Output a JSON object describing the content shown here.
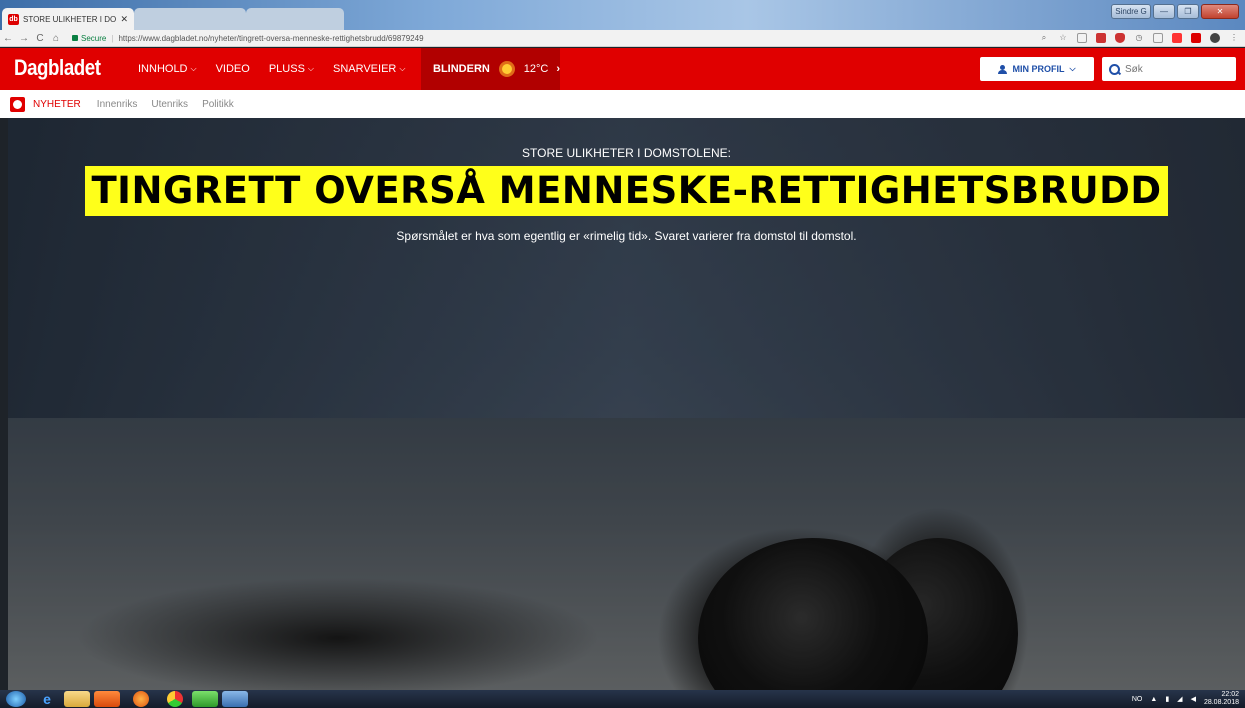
{
  "browser": {
    "tabs": [
      {
        "title": "STORE ULIKHETER I DOM",
        "active": true
      },
      {
        "title": "",
        "active": false
      },
      {
        "title": "",
        "active": false
      }
    ],
    "window_user": "Sindre G",
    "secure_label": "Secure",
    "url": "https://www.dagbladet.no/nyheter/tingrett-oversa-menneske-rettighetsbrudd/69879249"
  },
  "site": {
    "logo": "Dagbladet",
    "nav": [
      {
        "label": "INNHOLD",
        "dropdown": true
      },
      {
        "label": "VIDEO",
        "dropdown": false
      },
      {
        "label": "PLUSS",
        "dropdown": true
      },
      {
        "label": "SNARVEIER",
        "dropdown": true
      }
    ],
    "weather": {
      "location": "BLINDERN",
      "temp": "12°C",
      "icon": "sun-icon"
    },
    "profile_label": "MIN PROFIL",
    "search_placeholder": "Søk",
    "accent_color": "#e00000"
  },
  "subnav": {
    "section": "NYHETER",
    "items": [
      "Innenriks",
      "Utenriks",
      "Politikk"
    ]
  },
  "article": {
    "kicker": "STORE ULIKHETER I DOMSTOLENE:",
    "headline": "TINGRETT OVERSÅ MENNESKE-RETTIGHETSBRUDD",
    "lead": "Spørsmålet er hva som egentlig er «rimelig tid». Svaret varierer fra domstol til domstol.",
    "highlight_color": "#ffff1a"
  },
  "taskbar": {
    "lang": "NO",
    "time": "22:02",
    "date": "28.08.2018"
  }
}
